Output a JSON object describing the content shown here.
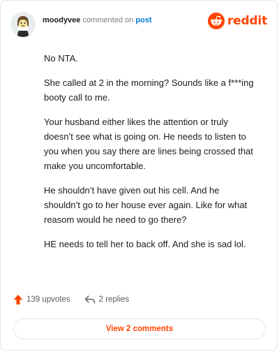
{
  "header": {
    "username": "moodyvee",
    "action_text": "commented on",
    "post_link": "post",
    "brand": "reddit"
  },
  "comment": {
    "paragraphs": [
      "No NTA.",
      "She called at 2 in the morning? Sounds like a f***ing booty call to me.",
      "Your husband either likes the attention or truly doesn’t see what is going on. He needs to listen to you when you say there are lines being crossed that make you uncomfortable.",
      "He shouldn’t have given out his cell. And he shouldn’t go to her house ever again. Like for what reasom would he need to go there?",
      "HE needs to tell her to back off. And she is sad lol."
    ]
  },
  "footer": {
    "upvotes": "139 upvotes",
    "replies": "2 replies",
    "view_comments": "View 2 comments"
  },
  "icons": {
    "avatar": "avatar-icon",
    "brand": "reddit-logo-icon",
    "upvote": "upvote-arrow-icon",
    "reply": "reply-arrow-icon"
  },
  "colors": {
    "accent": "#ff4500",
    "link": "#0079d3",
    "muted": "#7c7c7c"
  }
}
